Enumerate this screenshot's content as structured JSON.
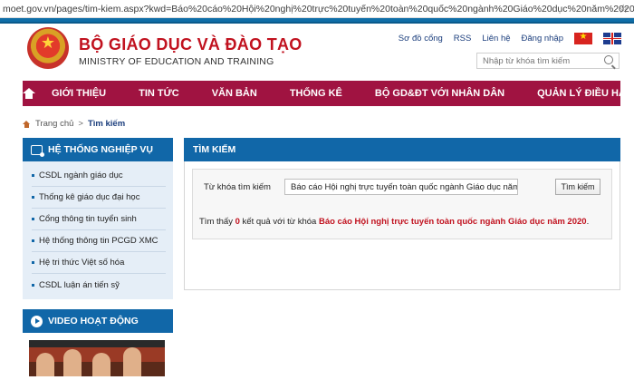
{
  "browser": {
    "url": "moet.gov.vn/pages/tim-kiem.aspx?kwd=Báo%20cáo%20Hội%20nghị%20trực%20tuyến%20toàn%20quốc%20ngành%20Giáo%20dục%20năm%202020"
  },
  "header": {
    "brand_vn": "BỘ GIÁO DỤC VÀ ĐÀO TẠO",
    "brand_en": "MINISTRY OF EDUCATION AND TRAINING",
    "links": [
      "Sơ đồ cổng",
      "RSS",
      "Liên hệ",
      "Đăng nhập"
    ],
    "search_placeholder": "Nhập từ khóa tìm kiếm"
  },
  "nav": {
    "items": [
      "GIỚI THIỆU",
      "TIN TỨC",
      "VĂN BẢN",
      "THỐNG KÊ",
      "BỘ GD&ĐT VỚI NHÂN DÂN",
      "QUẢN LÝ ĐIỀU HÀNH"
    ]
  },
  "breadcrumb": {
    "home": "Trang chủ",
    "separator": ">",
    "current": "Tìm kiếm"
  },
  "sidebar": {
    "title": "HỆ THỐNG NGHIỆP VỤ",
    "links": [
      "CSDL ngành giáo dục",
      "Thống kê giáo dục đại học",
      "Cổng thông tin tuyển sinh",
      "Hệ thống thông tin PCGD XMC",
      "Hệ tri thức Việt số hóa",
      "CSDL luận án tiến sỹ"
    ],
    "video_title": "VIDEO HOẠT ĐỘNG"
  },
  "main": {
    "title": "TÌM KIẾM",
    "keyword_label": "Từ khóa tìm kiếm",
    "keyword_value": "Báo cáo Hội nghị trực tuyến toàn quốc ngành Giáo dục năm 20",
    "search_button": "Tìm kiếm",
    "result_prefix": "Tìm thấy",
    "result_count": "0",
    "result_middle": "kết quả với từ khóa",
    "result_keyword": "Báo cáo Hội nghị trực tuyến toàn quốc ngành Giáo dục năm 2020",
    "result_suffix": "."
  },
  "colors": {
    "nav": "#a01341",
    "panel": "#1167a8",
    "brand_red": "#c1121f"
  }
}
